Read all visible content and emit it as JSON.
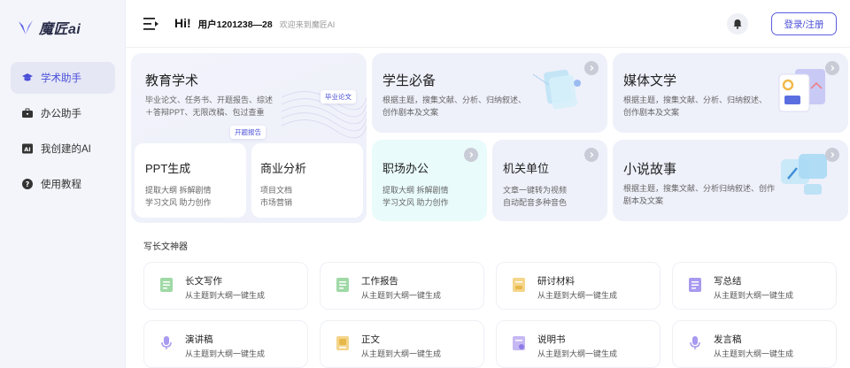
{
  "brand": {
    "name": "魔匠ai"
  },
  "sidebar": {
    "items": [
      {
        "label": "学术助手",
        "icon": "graduation-cap-icon",
        "active": true
      },
      {
        "label": "办公助手",
        "icon": "briefcase-icon",
        "active": false
      },
      {
        "label": "我创建的AI",
        "icon": "ai-badge-icon",
        "active": false
      },
      {
        "label": "使用教程",
        "icon": "help-circle-icon",
        "active": false
      }
    ]
  },
  "header": {
    "hi": "Hi!",
    "username": "用户1201238—28",
    "welcome": "欢迎来到魔匠AI",
    "login_label": "登录/注册"
  },
  "cards": {
    "edu": {
      "title": "教育学术",
      "desc_line1": "毕业论文、任务书、开题报告、综述",
      "desc_line2": "＋答辩PPT、无限改稿、包过查重",
      "tag_thesis": "毕业论文",
      "tag_report": "开题报告"
    },
    "ppt": {
      "title": "PPT生成",
      "desc_line1": "提取大纲 拆解剧情",
      "desc_line2": "学习文风 助力创作"
    },
    "biz": {
      "title": "商业分析",
      "desc_line1": "项目文档",
      "desc_line2": "市场营销"
    },
    "student": {
      "title": "学生必备",
      "desc_line1": "根据主题，搜集文献、分析、归纳叙述、",
      "desc_line2": "创作剧本及文案"
    },
    "media": {
      "title": "媒体文学",
      "desc_line1": "根据主题，搜集文献、分析、归纳叙述、",
      "desc_line2": "创作剧本及文案"
    },
    "office": {
      "title": "职场办公",
      "desc_line1": "提取大纲 拆解剧情",
      "desc_line2": "学习文风 助力创作"
    },
    "gov": {
      "title": "机关单位",
      "desc_line1": "文章一键转为视频",
      "desc_line2": "自动配音多种音色"
    },
    "novel": {
      "title": "小说故事",
      "desc_line1": "根据主题，搜集文献、分析归纳叙述、创作",
      "desc_line2": "剧本及文案"
    }
  },
  "section": {
    "title": "写长文神器",
    "tools": [
      {
        "name": "长文写作",
        "desc": "从主题到大纲一键生成",
        "icon": "green-doc-icon"
      },
      {
        "name": "工作报告",
        "desc": "从主题到大纲一键生成",
        "icon": "green-doc-icon"
      },
      {
        "name": "研讨材料",
        "desc": "从主题到大纲一键生成",
        "icon": "yellow-doc-icon"
      },
      {
        "name": "写总结",
        "desc": "从主题到大纲一键生成",
        "icon": "purple-doc-icon"
      },
      {
        "name": "演讲稿",
        "desc": "从主题到大纲一键生成",
        "icon": "microphone-icon"
      },
      {
        "name": "正文",
        "desc": "从主题到大纲一键生成",
        "icon": "yellow-book-icon"
      },
      {
        "name": "说明书",
        "desc": "从主题到大纲一键生成",
        "icon": "manual-icon"
      },
      {
        "name": "发言稿",
        "desc": "从主题到大纲一键生成",
        "icon": "microphone-icon"
      }
    ]
  },
  "colors": {
    "accent": "#4a4fd8",
    "sidebar_bg": "#f4f5fa"
  }
}
